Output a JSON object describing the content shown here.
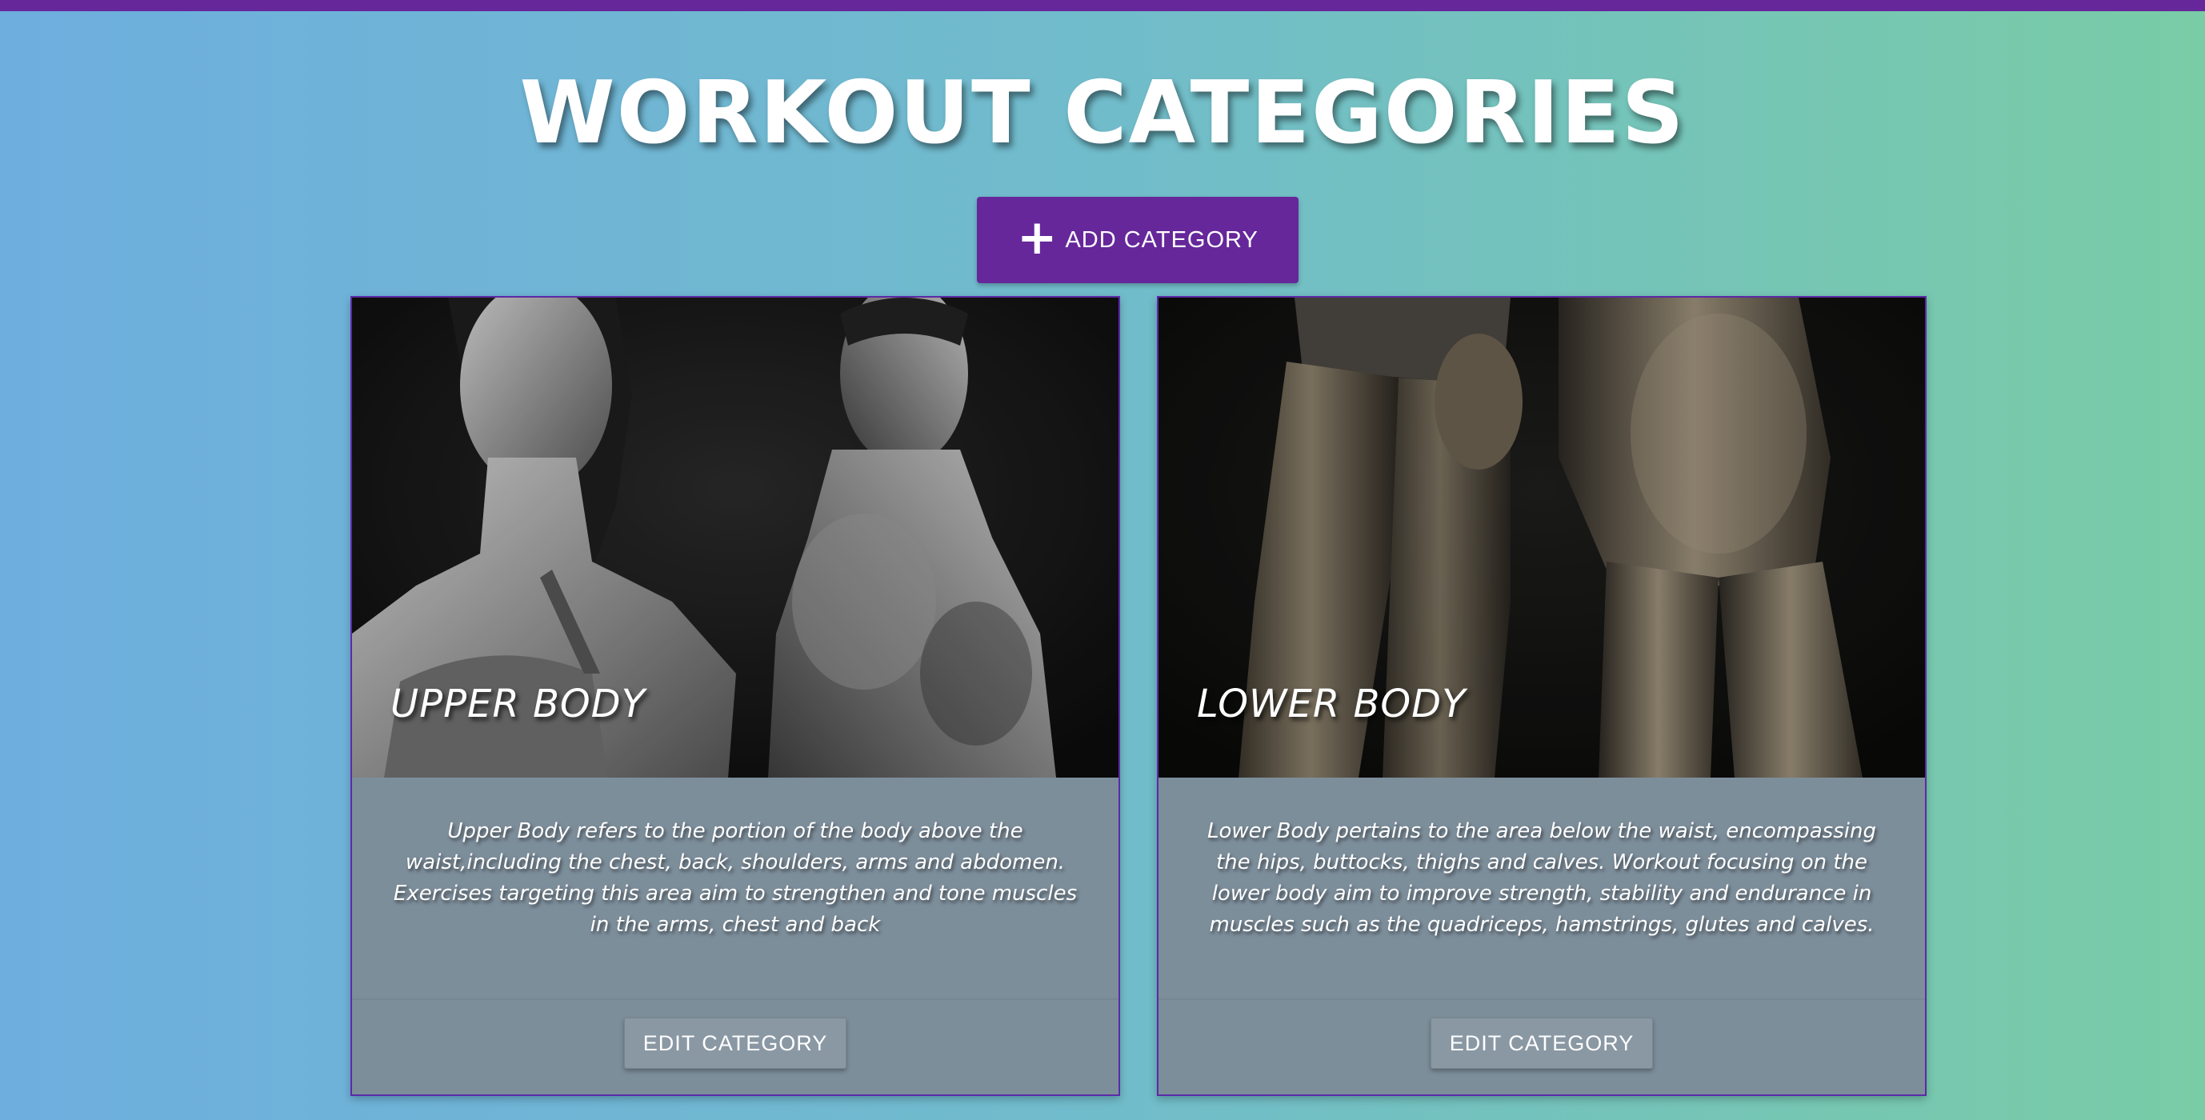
{
  "header": {
    "title": "WORKOUT CATEGORIES",
    "add_button_label": "ADD CATEGORY",
    "add_icon": "plus-icon"
  },
  "colors": {
    "accent": "#66279a",
    "card_body": "#7d8e9b",
    "gradient_start": "#6eaedf",
    "gradient_end": "#79cca6"
  },
  "categories": [
    {
      "title": "UPPER BODY",
      "description": "Upper Body refers to the portion of the body above the waist,including the chest, back, shoulders, arms and abdomen. Exercises targeting this area aim to strengthen and tone muscles in the arms, chest and back",
      "edit_label": "EDIT CATEGORY"
    },
    {
      "title": "LOWER BODY",
      "description": "Lower Body pertains to the area below the waist, encompassing the hips, buttocks, thighs and calves. Workout focusing on the lower body aim to improve strength, stability and endurance in muscles such as the quadriceps, hamstrings, glutes and calves.",
      "edit_label": "EDIT CATEGORY"
    }
  ]
}
